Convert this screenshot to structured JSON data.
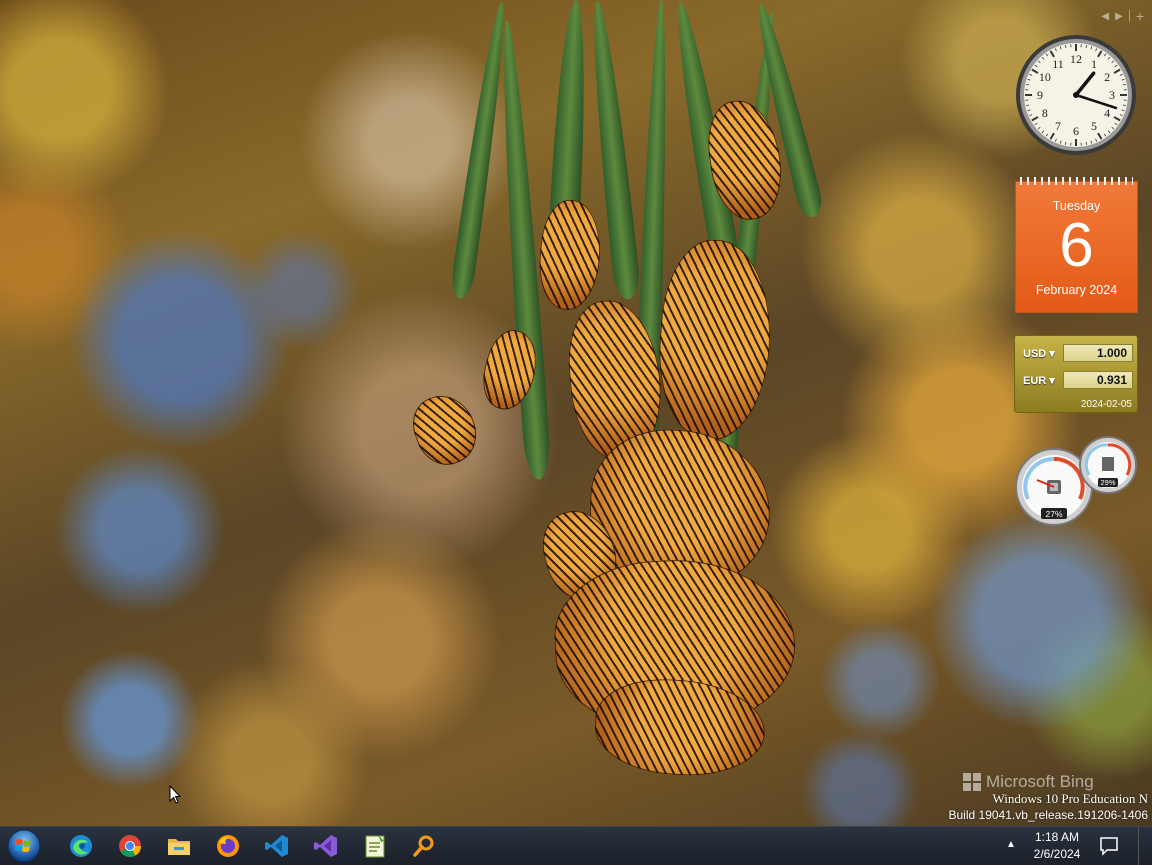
{
  "wallpaper": {
    "brand": "Microsoft Bing",
    "os_line1": "Windows 10 Pro Education N",
    "os_line2": "Build 19041.vb_release.191206-1406"
  },
  "calendar": {
    "weekday": "Tuesday",
    "day": "6",
    "month_year": "February 2024"
  },
  "currency": {
    "rows": [
      {
        "code": "USD",
        "value": "1.000"
      },
      {
        "code": "EUR",
        "value": "0.931"
      }
    ],
    "date": "2024-02-05"
  },
  "meters": {
    "cpu_percent": "27%",
    "memory_percent": "29%"
  },
  "clock_gadget": {
    "hour_numbers": [
      "12",
      "1",
      "2",
      "3",
      "4",
      "5",
      "6",
      "7",
      "8",
      "9",
      "10",
      "11"
    ],
    "hour_hand_deg": 39,
    "minute_hand_deg": 108
  },
  "taskbar": {
    "icons": [
      "windows-start-icon",
      "edge-icon",
      "chrome-icon",
      "file-explorer-icon",
      "firefox-icon",
      "vscode-icon",
      "visual-studio-icon",
      "notepad-plus-icon",
      "search-tool-icon"
    ],
    "time": "1:18 AM",
    "date": "2/6/2024"
  },
  "colors": {
    "calendar": "#e45a16",
    "currency": "#b5a338",
    "taskbar": "#1f2530"
  }
}
